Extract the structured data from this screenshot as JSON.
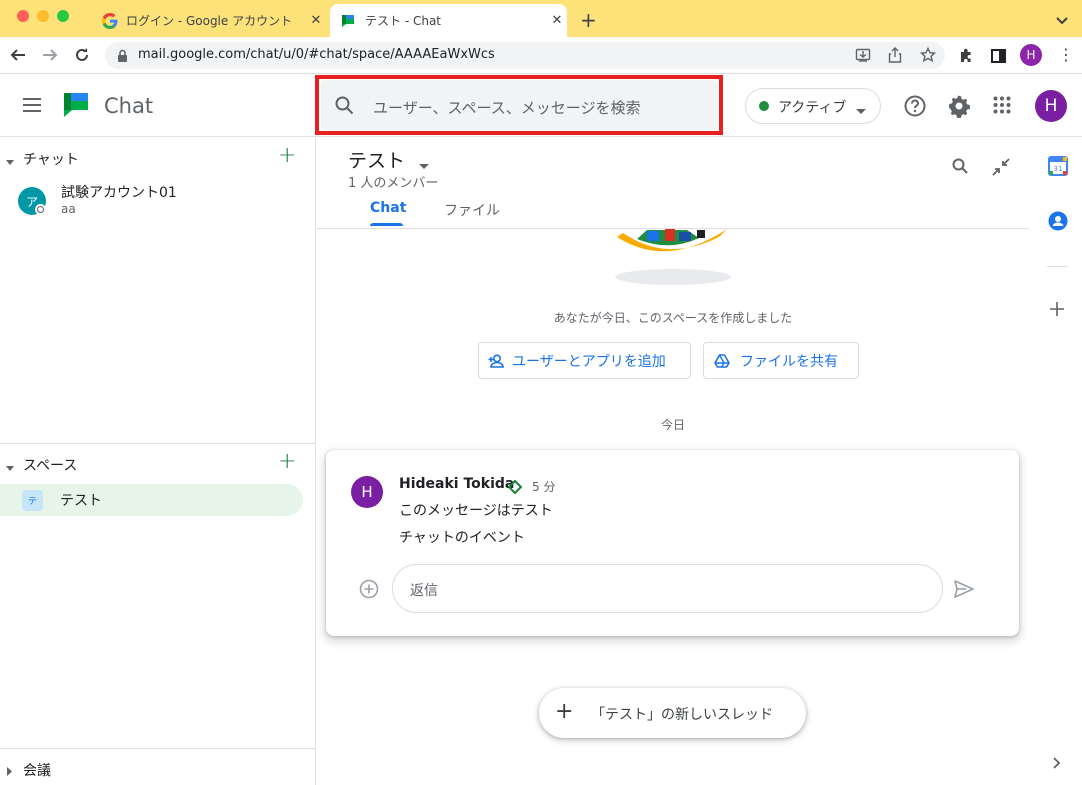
{
  "browser": {
    "tabs": [
      {
        "title": "ログイン - Google アカウント",
        "icon": "google-g-icon"
      },
      {
        "title": "テスト - Chat",
        "icon": "chat-icon"
      }
    ],
    "new_tab": "+",
    "url": "mail.google.com/chat/u/0/#chat/space/AAAAEaWxWcs",
    "profile_initial": "H"
  },
  "header": {
    "app_name": "Chat",
    "search_placeholder": "ユーザー、スペース、メッセージを検索",
    "status_label": "アクティブ",
    "avatar_initial": "H",
    "colors": {
      "active_dot": "#1e8e3e",
      "avatar": "#7b1fa2",
      "highlight_box": "#ea1f1f"
    }
  },
  "sidebar": {
    "chat_section": {
      "title": "チャット",
      "items": [
        {
          "avatar": "ア",
          "name": "試験アカウント01",
          "subtitle": "aa"
        }
      ]
    },
    "spaces_section": {
      "title": "スペース",
      "items": [
        {
          "avatar": "テ",
          "name": "テスト",
          "selected": true
        }
      ]
    },
    "meet_section": {
      "title": "会議"
    }
  },
  "space": {
    "title": "テスト",
    "member_count": "1 人のメンバー",
    "tabs": [
      {
        "label": "Chat",
        "active": true
      },
      {
        "label": "ファイル",
        "active": false
      }
    ],
    "created_notice": "あなたが今日、このスペースを作成しました",
    "add_people_button": "ユーザーとアプリを追加",
    "share_file_button": "ファイルを共有",
    "date_divider": "今日",
    "message": {
      "avatar": "H",
      "author": "Hideaki Tokida",
      "time": "5 分",
      "lines": [
        "このメッセージはテスト",
        "チャットのイベント"
      ]
    },
    "reply_placeholder": "返信",
    "new_thread_button": "「テスト」の新しいスレッド"
  }
}
